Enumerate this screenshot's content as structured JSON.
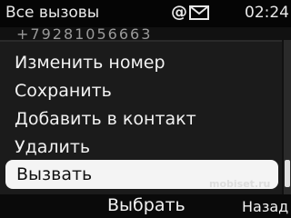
{
  "status": {
    "title": "Все вызовы",
    "at_symbol": "@",
    "time": "02:24",
    "icons": [
      "at-icon",
      "mail-icon"
    ]
  },
  "background_list": {
    "peek_text": "+79281056663"
  },
  "menu": {
    "items": [
      {
        "label": "Изменить номер"
      },
      {
        "label": "Сохранить"
      },
      {
        "label": "Добавить в контакт"
      },
      {
        "label": "Удалить"
      },
      {
        "label": "Вызвать"
      }
    ],
    "selected_index": 4
  },
  "watermark": "mobiset.ru",
  "softkeys": {
    "center": "Выбрать",
    "right": "Назад"
  },
  "colors": {
    "highlight": "#f4f4f4",
    "background": "#1b1b1b",
    "text": "#f2f2f2"
  }
}
